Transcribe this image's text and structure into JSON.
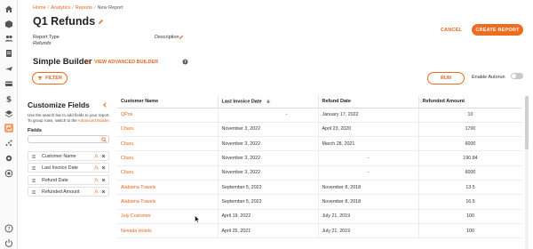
{
  "breadcrumb": {
    "home": "Home",
    "analytics": "Analytics",
    "reports": "Reports",
    "current": "New Report",
    "separator": "/"
  },
  "header": {
    "title": "Q1 Refunds",
    "report_type_label": "Report Type",
    "report_type_value": "Refunds",
    "description_label": "Description",
    "cancel_label": "CANCEL",
    "create_label": "CREATE REPORT"
  },
  "builder": {
    "title": "Simple Builder",
    "advanced_link": "VIEW ADVANCED BUILDER",
    "filter_label": "FILTER",
    "run_label": "RUN",
    "autorun_label": "Enable Autorun",
    "autorun_on": false
  },
  "panel": {
    "title": "Customize Fields",
    "help_text": "Use the search bar to add fields to your report. To group rows, switch to the ",
    "help_link": "Advanced Builder.",
    "fields_label": "Fields",
    "search_value": "",
    "fields": [
      {
        "name": "Customer Name",
        "fx": "fx"
      },
      {
        "name": "Last Invoice Date",
        "fx": "fx"
      },
      {
        "name": "Refund Date",
        "fx": "fx"
      },
      {
        "name": "Refunded Amount",
        "fx": "fx"
      }
    ]
  },
  "table": {
    "columns": [
      "Customer Name",
      "Last Invoice Date",
      "Refund Date",
      "Refunded Amount"
    ],
    "rows": [
      [
        "QPos",
        "-",
        "January 17, 2022",
        "10"
      ],
      [
        "Charu",
        "November 3, 2022",
        "April 23, 2020",
        "1700"
      ],
      [
        "Charu",
        "November 3, 2022",
        "March 28, 2021",
        "6000"
      ],
      [
        "Charu",
        "November 3, 2022",
        "-",
        "190.84"
      ],
      [
        "Charu",
        "November 3, 2022",
        "-",
        "6000"
      ],
      [
        "Alabama Travels",
        "September 5, 2022",
        "November 8, 2018",
        "13.5"
      ],
      [
        "Alabama Travels",
        "September 5, 2022",
        "November 8, 2018",
        "16.5"
      ],
      [
        "July Customer",
        "April 19, 2022",
        "July 21, 2019",
        "100"
      ],
      [
        "Nevada Hotels",
        "April 25, 2021",
        "July 21, 2019",
        "100"
      ]
    ]
  },
  "colors": {
    "accent": "#ef6c1e",
    "link": "#e8651e",
    "active_rail_bg": "#fde3d0"
  },
  "rail_icons": [
    "home-icon",
    "box-icon",
    "users-icon",
    "document-icon",
    "plane-icon",
    "card-icon",
    "dollar-icon",
    "layers-icon",
    "chart-icon",
    "scatter-icon",
    "settings-icon",
    "globe-icon",
    "help-icon",
    "power-icon"
  ]
}
